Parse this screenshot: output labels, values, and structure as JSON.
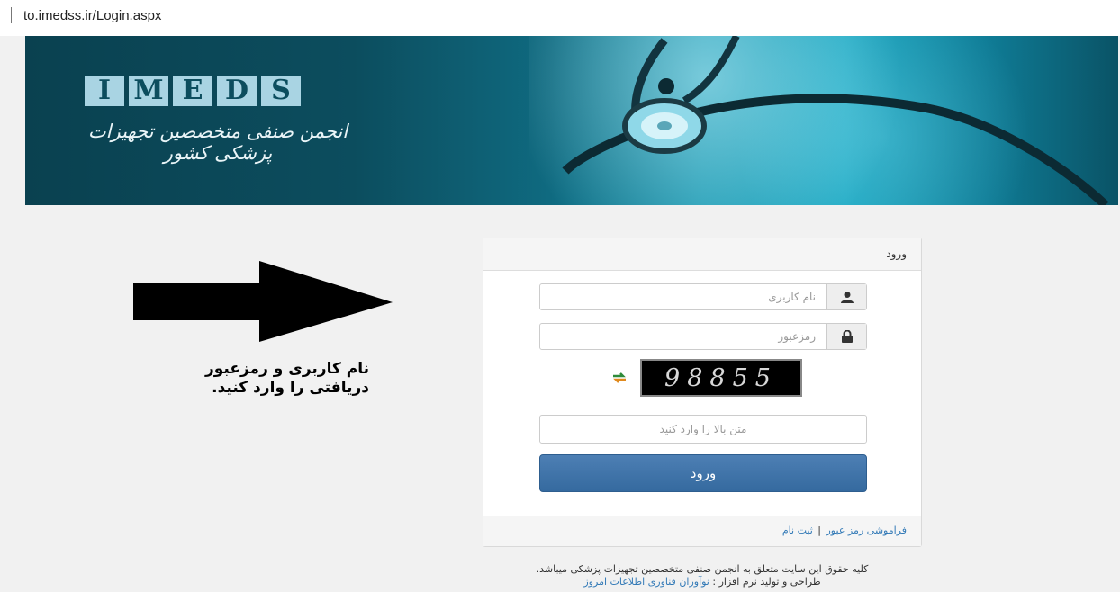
{
  "browser": {
    "url": "to.imedss.ir/Login.aspx"
  },
  "banner": {
    "logo_letters": [
      "I",
      "M",
      "E",
      "D",
      "S"
    ],
    "subtitle": "انجمن صنفی متخصصین تجهیزات پزشکی کشور",
    "colors": {
      "dark": "#0a4150",
      "light": "#1aa6c0",
      "logo_box": "#a9d4e3"
    }
  },
  "annotation": {
    "line1": "نام کاربری و رمزعبور",
    "line2": "دریافتی را وارد کنید."
  },
  "login": {
    "header": "ورود",
    "username_icon": "user-icon",
    "username_placeholder": "نام کاربری",
    "password_icon": "lock-icon",
    "password_placeholder": "رمزعبور",
    "refresh_icon": "refresh-icon",
    "captcha_text": "98855",
    "captcha_placeholder": "متن بالا را وارد کنید",
    "submit_label": "ورود",
    "forgot_label": "فراموشی رمز عبور",
    "separator": "|",
    "register_label": "ثبت نام",
    "submit_color": "#3d74aa"
  },
  "footer": {
    "copyright": "کلیه حقوق این سایت متعلق به انجمن صنفی متخصصین تجهیزات پزشکی میباشد.",
    "credit_prefix": "طراحی و تولید نرم افزار :",
    "credit_link": "نوآوران فناوری اطلاعات امروز"
  }
}
